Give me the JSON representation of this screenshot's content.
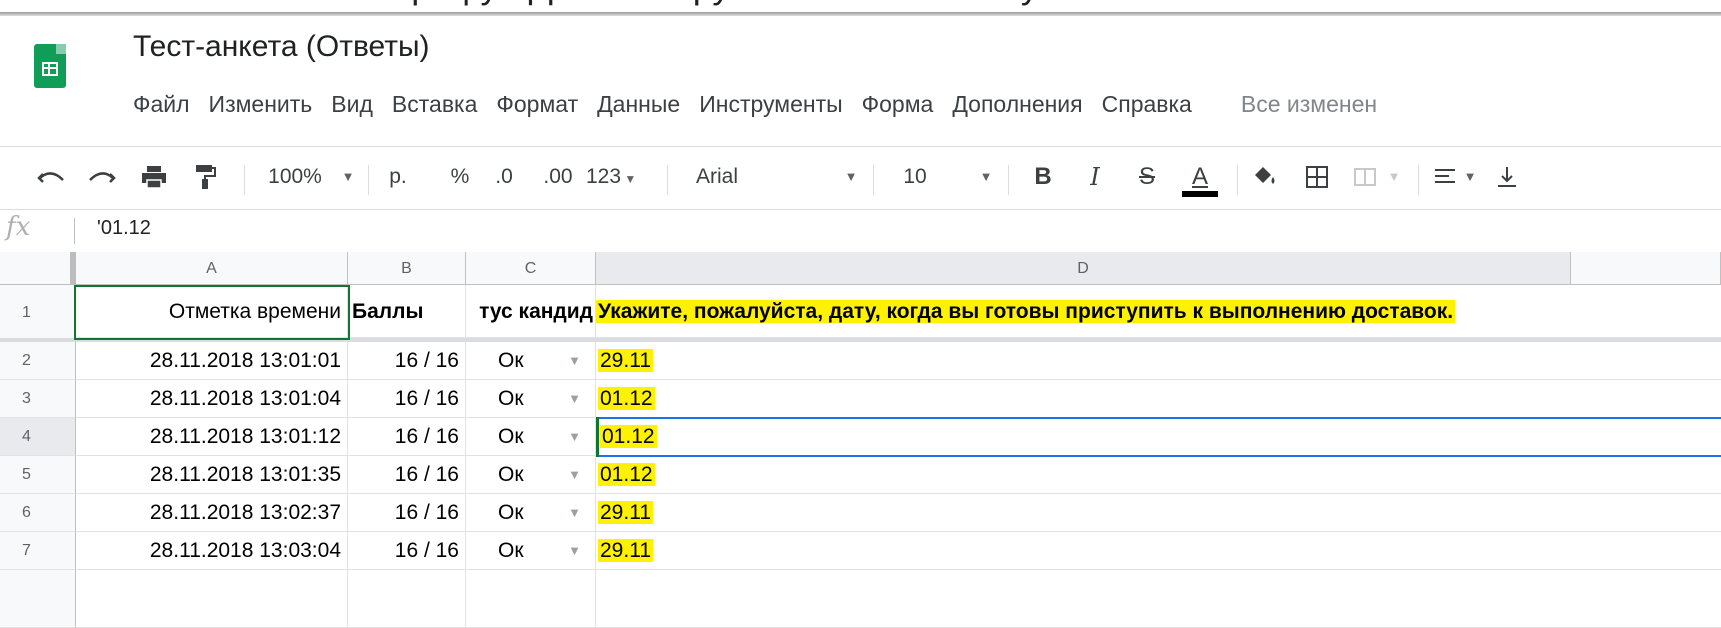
{
  "caption_text": "и ставится в графу «Дата инструктажа» в зене в нужный",
  "document": {
    "title": "Тест-анкета (Ответы)"
  },
  "menu": {
    "items": [
      "Файл",
      "Изменить",
      "Вид",
      "Вставка",
      "Формат",
      "Данные",
      "Инструменты",
      "Форма",
      "Дополнения",
      "Справка"
    ],
    "status": "Все изменен"
  },
  "toolbar": {
    "zoom": "100%",
    "currency": "р.",
    "percent": "%",
    "decimal_decrease": ".0",
    "decimal_increase": ".00",
    "number_format": "123",
    "font": "Arial",
    "font_size": "10",
    "bold": "B",
    "italic": "I",
    "strike": "S",
    "text_color": "A"
  },
  "formula_bar": {
    "fx": "fx",
    "value": "'01.12"
  },
  "columns": [
    "A",
    "B",
    "C",
    "D"
  ],
  "rows": [
    "1",
    "2",
    "3",
    "4",
    "5",
    "6",
    "7"
  ],
  "header_row": {
    "a": "Отметка времени",
    "b": "Баллы",
    "c": "тус кандид",
    "d": "Укажите, пожалуйста, дату, когда вы готовы приступить к выполнению доставок."
  },
  "data_rows": [
    {
      "a": "28.11.2018 13:01:01",
      "b": "16 / 16",
      "c": "Ок",
      "d": "29.11"
    },
    {
      "a": "28.11.2018 13:01:04",
      "b": "16 / 16",
      "c": "Ок",
      "d": "01.12"
    },
    {
      "a": "28.11.2018 13:01:12",
      "b": "16 / 16",
      "c": "Ок",
      "d": "01.12"
    },
    {
      "a": "28.11.2018 13:01:35",
      "b": "16 / 16",
      "c": "Ок",
      "d": "01.12"
    },
    {
      "a": "28.11.2018 13:02:37",
      "b": "16 / 16",
      "c": "Ок",
      "d": "29.11"
    },
    {
      "a": "28.11.2018 13:03:04",
      "b": "16 / 16",
      "c": "Ок",
      "d": "29.11"
    }
  ],
  "colors": {
    "highlight": "#fff200",
    "sheets_green": "#0f9d58",
    "selection_blue": "#1a73e8"
  }
}
